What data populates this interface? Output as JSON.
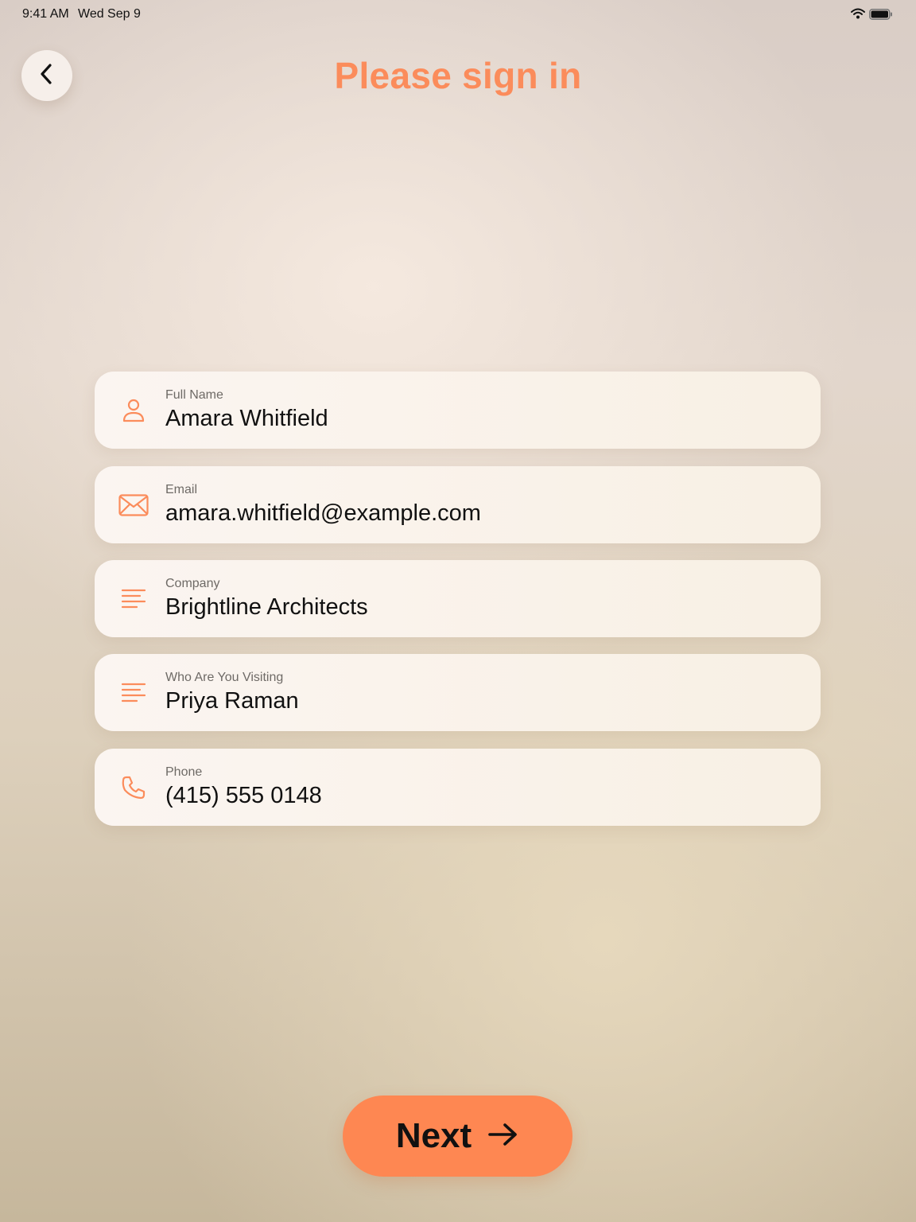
{
  "status_bar": {
    "time": "9:41 AM",
    "date": "Wed Sep 9",
    "icons": [
      "wifi-icon",
      "battery-icon"
    ]
  },
  "header": {
    "back_icon": "chevron-left-icon",
    "title": "Please sign in"
  },
  "form": {
    "fields": [
      {
        "label": "Full Name",
        "value": "Amara Whitfield",
        "icon": "person-icon"
      },
      {
        "label": "Email",
        "value": "amara.whitfield@example.com",
        "icon": "envelope-icon"
      },
      {
        "label": "Company",
        "value": "Brightline Architects",
        "icon": "text-lines-icon"
      },
      {
        "label": "Who Are You Visiting",
        "value": "Priya Raman",
        "icon": "text-lines-icon"
      },
      {
        "label": "Phone",
        "value": "(415) 555 0148",
        "icon": "phone-icon"
      }
    ]
  },
  "footer": {
    "next_label": "Next",
    "next_icon": "arrow-right-icon"
  },
  "colors": {
    "accent": "#fb8c5b",
    "button": "#fe8752",
    "text": "#111111",
    "label": "#6e6a66"
  }
}
